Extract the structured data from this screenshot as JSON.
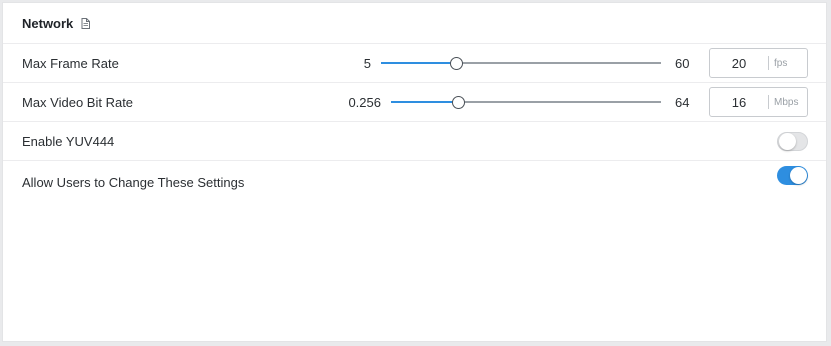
{
  "section": {
    "title": "Network",
    "title_icon": "document-icon"
  },
  "settings": {
    "frame_rate": {
      "label": "Max Frame Rate",
      "min": "5",
      "max": "60",
      "value": "20",
      "unit": "fps",
      "slider_fraction": 0.27
    },
    "bit_rate": {
      "label": "Max Video Bit Rate",
      "min": "0.256",
      "max": "64",
      "value": "16",
      "unit": "Mbps",
      "slider_fraction": 0.25
    },
    "yuv444": {
      "label": "Enable YUV444",
      "enabled": false
    },
    "allow_users": {
      "label": "Allow Users to Change These Settings",
      "enabled": true
    }
  },
  "colors": {
    "accent": "#2e8ee0",
    "track": "#9aa0a6",
    "toggle_off": "#e4e5e7"
  }
}
